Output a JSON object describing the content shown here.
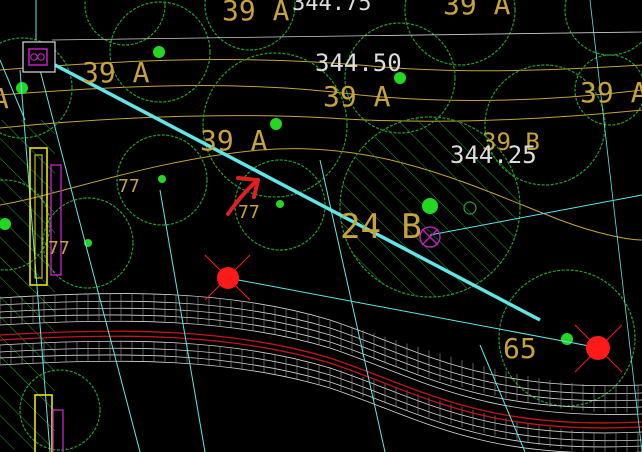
{
  "colors": {
    "background": "#000000",
    "tree_green": "#1fa02a",
    "tree_dot": "#22d822",
    "road_line": "#e6e6e6",
    "road_center": "#c01818",
    "pipe_cyan": "#5fe6e6",
    "contour_yellow": "#c8a23a",
    "label_yellow": "#c8a23a",
    "elevation_white": "#dddddd",
    "marker_red": "#ff1a1a",
    "arrow_red": "#e02020",
    "structure_yellow": "#e6e600",
    "structure_magenta": "#c020c0"
  },
  "labels": {
    "top_left": "39 A",
    "top_mid": "344.75",
    "top_right": "39 A",
    "elev_344_50": "344.50",
    "elev_344_25": "344.25",
    "lbl_39a_1": "39 A",
    "lbl_39a_2": "39 A",
    "lbl_39a_3": "39 A",
    "lbl_39a_4": "39 A",
    "lbl_39a_left": "A",
    "lbl_39b": "39 B",
    "lbl_24b": "24 B",
    "lbl_65": "65",
    "lbl_77_a": "77",
    "lbl_77_b": "77",
    "lbl_77_c": "77"
  },
  "icons": {
    "manhole": "manhole-icon",
    "hydrant_1": "red-marker-icon",
    "hydrant_2": "red-marker-icon",
    "valve": "valve-icon",
    "arrow": "arrow-annotation-icon"
  }
}
